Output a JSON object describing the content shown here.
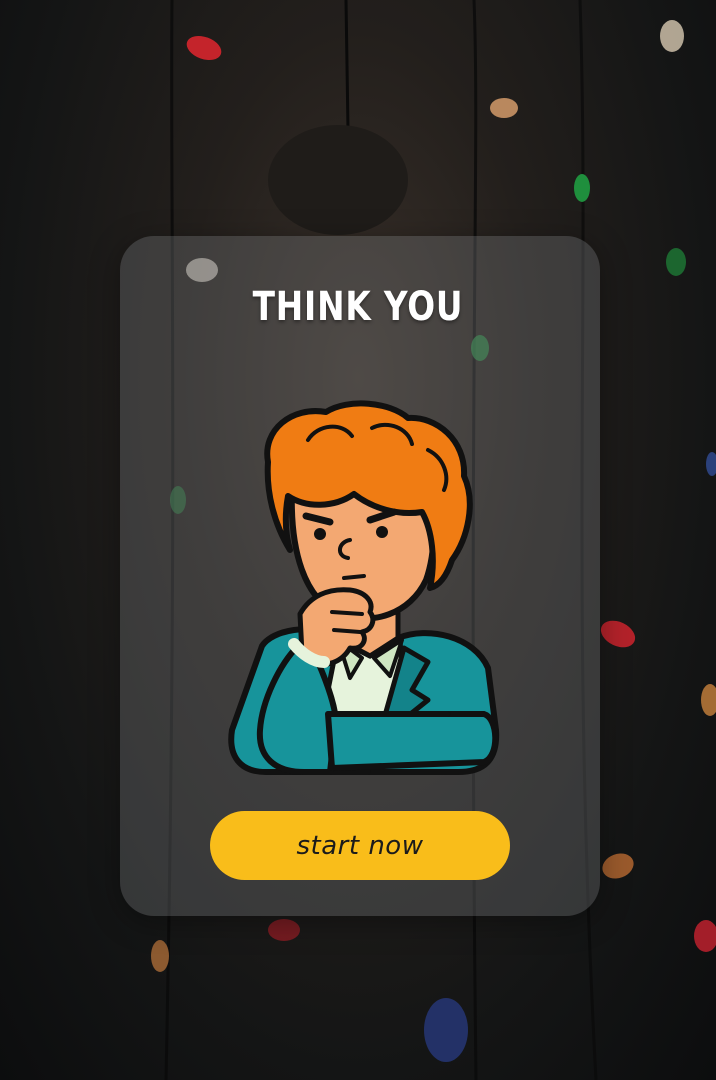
{
  "card": {
    "title": "THINK YOU"
  },
  "illustration": {
    "name": "thinking-man-icon"
  },
  "actions": {
    "start_label": "start now"
  },
  "colors": {
    "button": "#f9bd1a",
    "card_overlay": "#787c7e",
    "hair": "#f07c13",
    "skin": "#f3a872",
    "jacket": "#17949b",
    "shirt": "#e6f3dc"
  }
}
